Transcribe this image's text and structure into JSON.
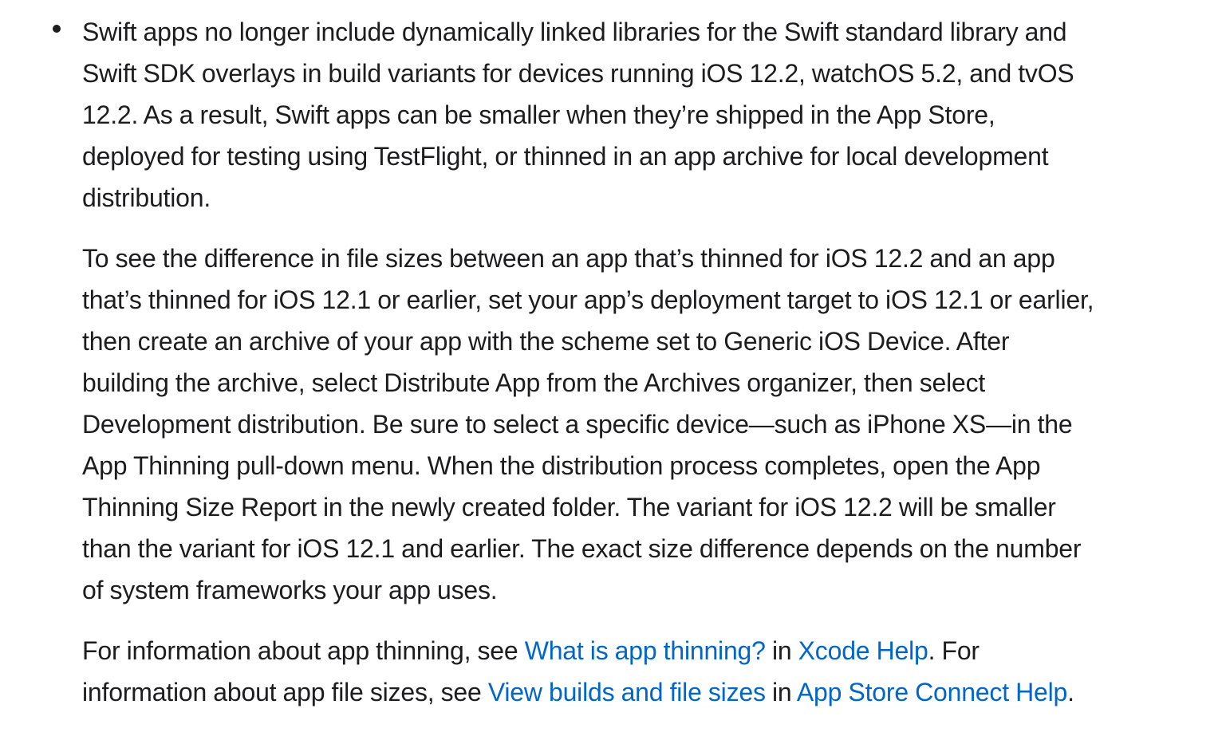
{
  "paragraph1": {
    "lines": [
      "Swift apps no longer include dynamically linked libraries for the Swift standard library and",
      "Swift SDK overlays in build variants for devices running iOS 12.2, watchOS 5.2, and tvOS",
      "12.2. As a result, Swift apps can be smaller when they’re shipped in the App Store,",
      "deployed for testing using TestFlight, or thinned in an app archive for local development",
      "distribution."
    ]
  },
  "paragraph2": {
    "lines": [
      "To see the difference in file sizes between an app that’s thinned for iOS 12.2 and an app",
      "that’s thinned for iOS 12.1 or earlier, set your app’s deployment target to iOS 12.1 or earlier,",
      "then create an archive of your app with the scheme set to Generic iOS Device. After",
      "building the archive, select Distribute App from the Archives organizer, then select",
      "Development distribution. Be sure to select a specific device—such as iPhone XS—in the",
      "App Thinning pull-down menu. When the distribution process completes, open the App",
      "Thinning Size Report in the newly created folder. The variant for iOS 12.2 will be smaller",
      "than the variant for iOS 12.1 and earlier. The exact size difference depends on the number",
      "of system frameworks your app uses."
    ]
  },
  "paragraph3": {
    "text1": "For information about app thinning, see ",
    "link1": "What is app thinning?",
    "text2": " in ",
    "link2": "Xcode Help",
    "text3": ". For",
    "text4": "information about app file sizes, see ",
    "link3": "View builds and file sizes",
    "text5": " in ",
    "link4": "App Store Connect Help",
    "text6": "."
  },
  "colors": {
    "text": "#1d1d1f",
    "link": "#0066cc",
    "background": "#ffffff"
  }
}
